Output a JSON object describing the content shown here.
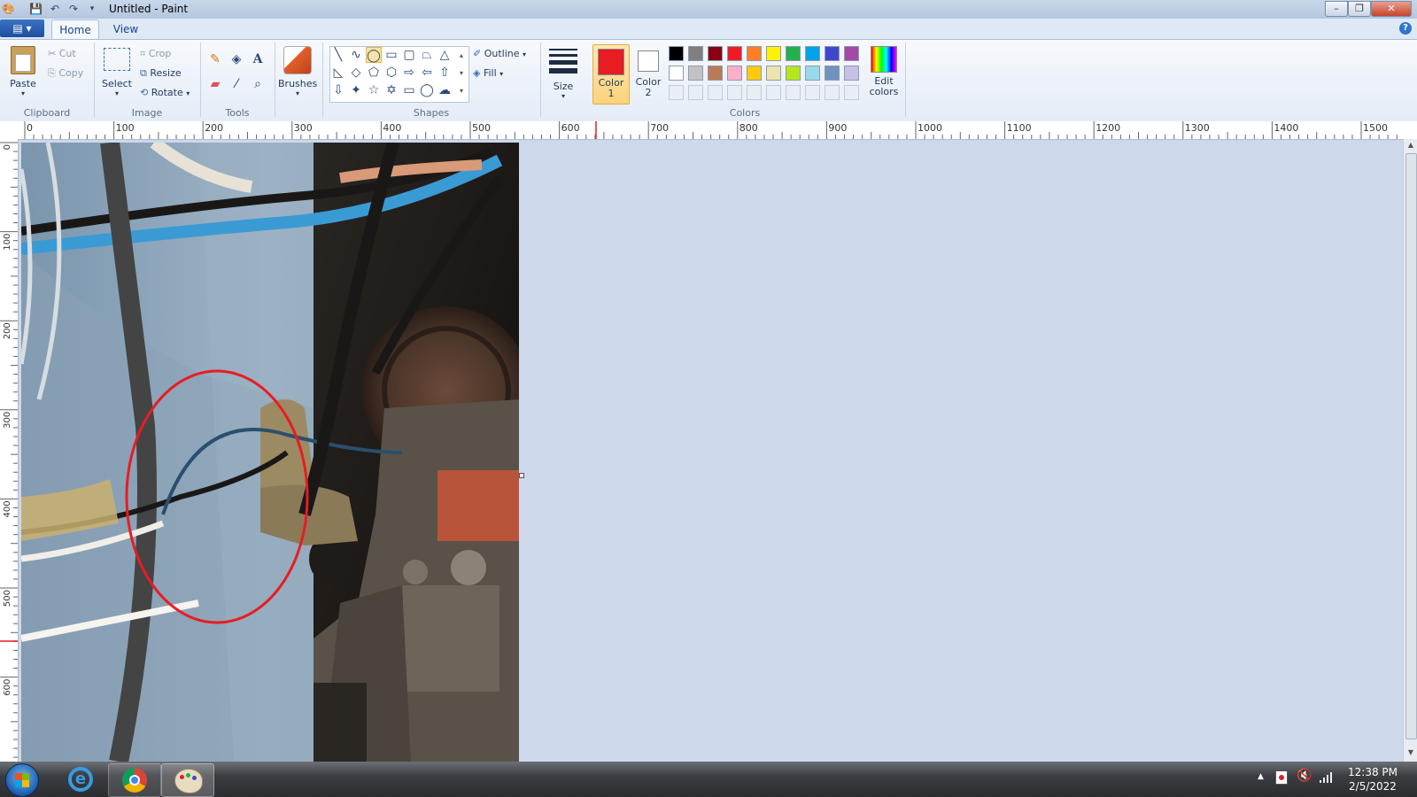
{
  "window": {
    "title": "Untitled - Paint",
    "minimize_icon": "minimize-icon",
    "restore_icon": "restore-icon",
    "close_label": "✕"
  },
  "quick_access": [
    "save-icon",
    "undo-icon",
    "redo-icon",
    "customize-icon"
  ],
  "tabs": {
    "file_icon": "paint-menu-icon",
    "home": "Home",
    "view": "View",
    "help": "?"
  },
  "ribbon": {
    "clipboard": {
      "group": "Clipboard",
      "paste": "Paste",
      "cut": "Cut",
      "copy": "Copy"
    },
    "image": {
      "group": "Image",
      "select": "Select",
      "crop": "Crop",
      "resize": "Resize",
      "rotate": "Rotate"
    },
    "tools": {
      "group": "Tools"
    },
    "brushes": {
      "label": "Brushes"
    },
    "shapes": {
      "group": "Shapes",
      "outline": "Outline",
      "fill": "Fill"
    },
    "size": {
      "label": "Size"
    },
    "colors": {
      "group": "Colors",
      "color1_label": "Color",
      "color1_num": "1",
      "color2_label": "Color",
      "color2_num": "2",
      "edit_label": "Edit",
      "edit_label2": "colors",
      "color1": "#e81c23",
      "color2": "#ffffff",
      "palette_row1": [
        "#000000",
        "#7f7f7f",
        "#880015",
        "#ed1c24",
        "#ff7f27",
        "#fff200",
        "#22b14c",
        "#00a2e8",
        "#3f48cc",
        "#a349a4"
      ],
      "palette_row2": [
        "#ffffff",
        "#c3c3c3",
        "#b97a57",
        "#ffaec9",
        "#ffc90e",
        "#efe4b0",
        "#b5e61d",
        "#99d9ea",
        "#7092be",
        "#c8bfe7"
      ]
    }
  },
  "ruler_h": [
    "0",
    "100",
    "200",
    "300",
    "400",
    "500",
    "600",
    "700",
    "800",
    "900",
    "1000",
    "1100",
    "1200",
    "1300",
    "1400",
    "1500"
  ],
  "ruler_v": [
    "0",
    "100",
    "200",
    "300",
    "400",
    "500",
    "600"
  ],
  "taskbar": {
    "apps": [
      "start-orb-icon",
      "internet-explorer-icon",
      "chrome-icon",
      "paint-icon"
    ],
    "time": "12:38 PM",
    "date": "2/5/2022"
  }
}
